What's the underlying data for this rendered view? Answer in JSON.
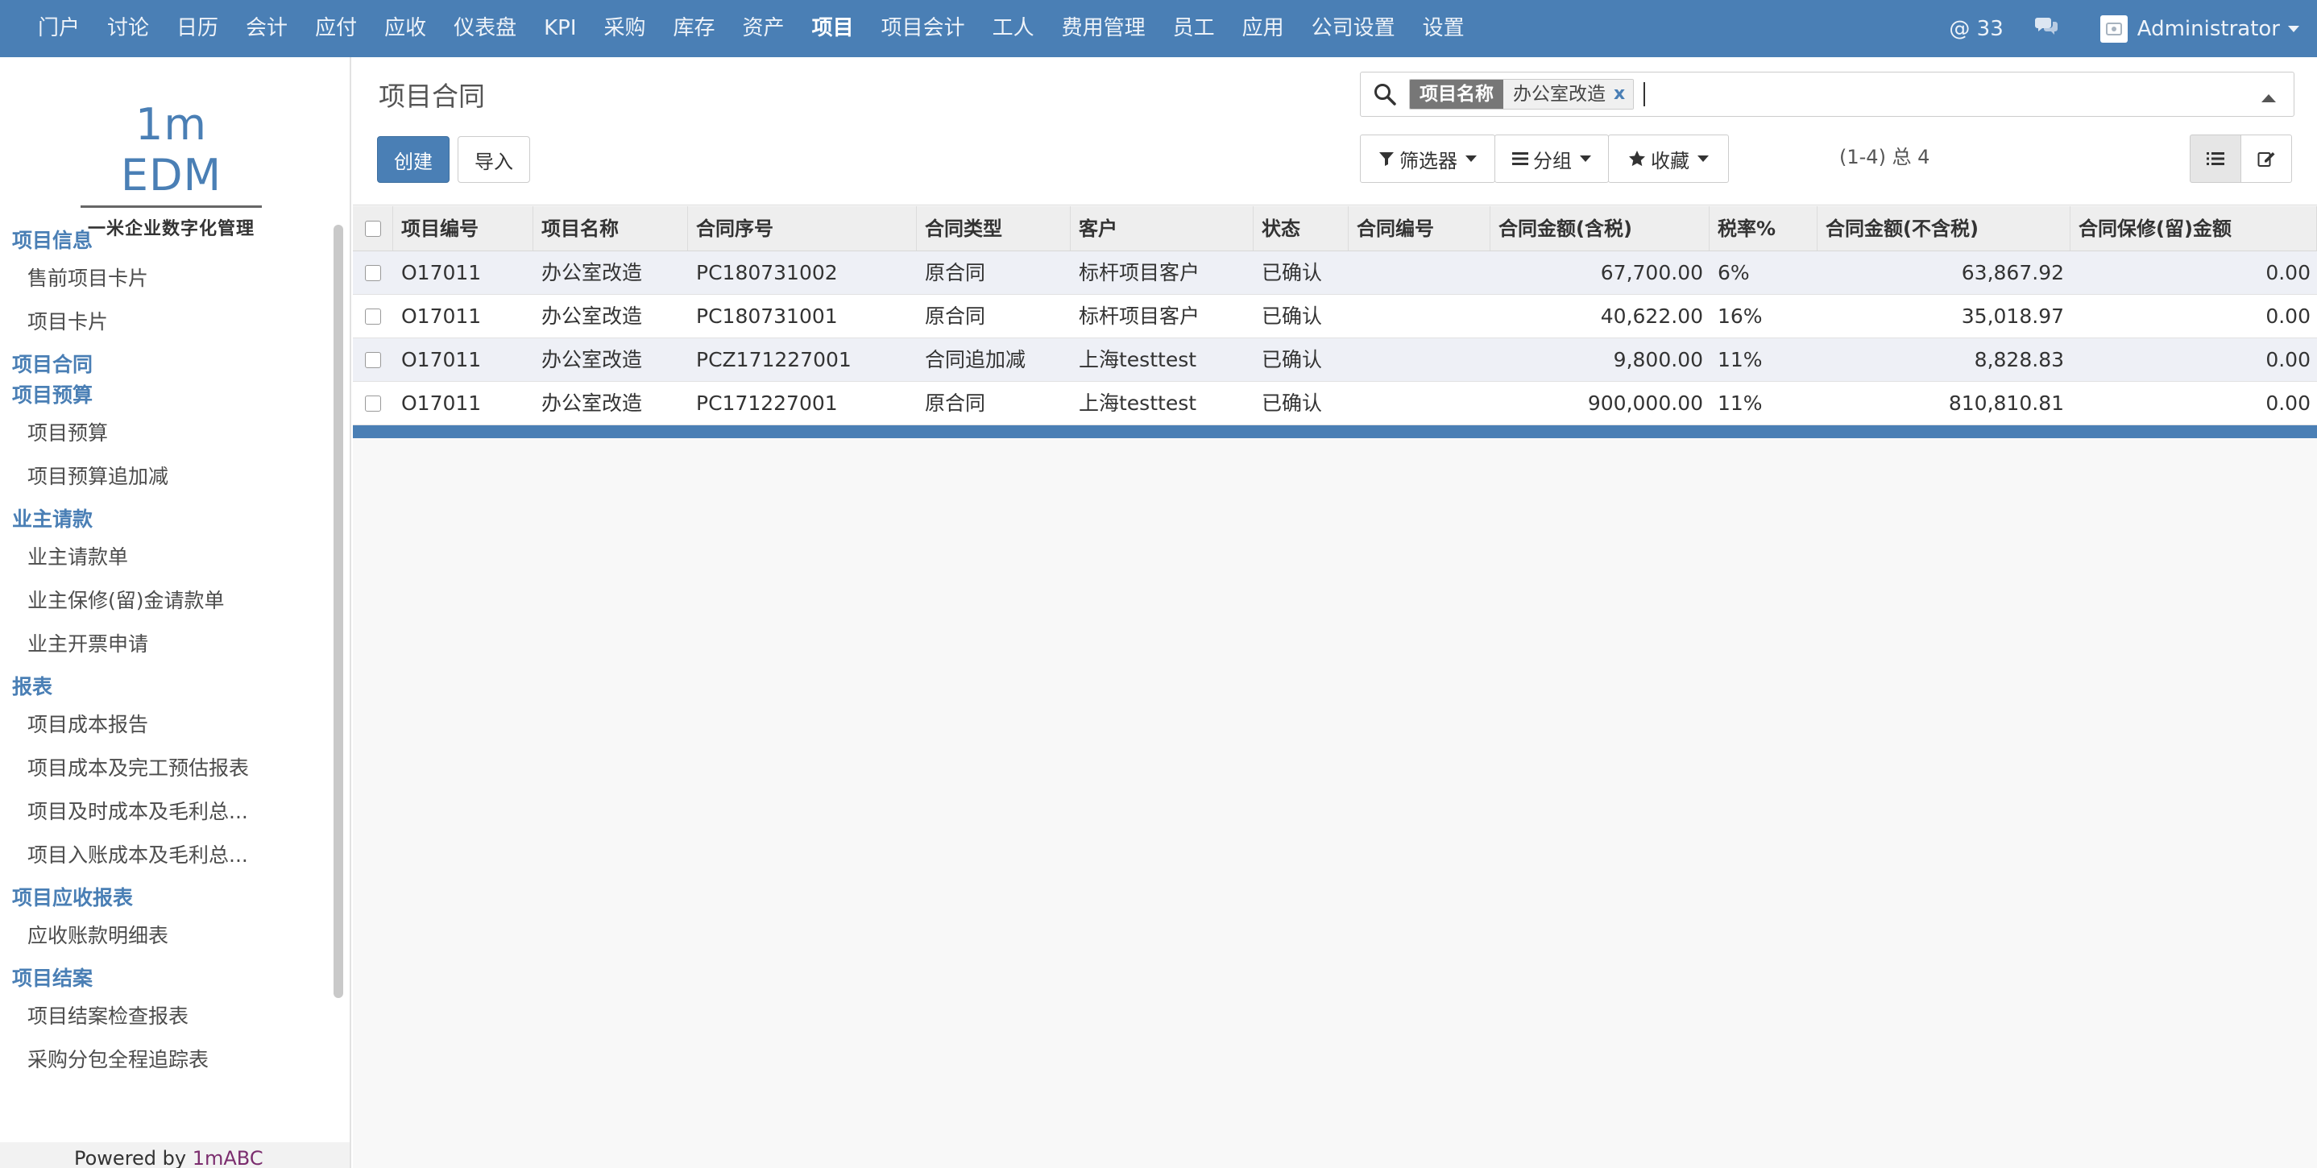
{
  "topnav": {
    "items": [
      "门户",
      "讨论",
      "日历",
      "会计",
      "应付",
      "应收",
      "仪表盘",
      "KPI",
      "采购",
      "库存",
      "资产",
      "项目",
      "项目会计",
      "工人",
      "费用管理",
      "员工",
      "应用",
      "公司设置",
      "设置"
    ],
    "active_index": 11,
    "mentions": "@ 33",
    "user": "Administrator"
  },
  "sidebar": {
    "logo_brand": "1m EDM",
    "logo_tagline": "一米企业数字化管理",
    "menu": [
      {
        "type": "section",
        "label": "项目信息"
      },
      {
        "type": "item",
        "label": "售前项目卡片"
      },
      {
        "type": "item",
        "label": "项目卡片"
      },
      {
        "type": "section",
        "label": "项目合同"
      },
      {
        "type": "section",
        "label": "项目预算"
      },
      {
        "type": "item",
        "label": "项目预算"
      },
      {
        "type": "item",
        "label": "项目预算追加减"
      },
      {
        "type": "section",
        "label": "业主请款"
      },
      {
        "type": "item",
        "label": "业主请款单"
      },
      {
        "type": "item",
        "label": "业主保修(留)金请款单"
      },
      {
        "type": "item",
        "label": "业主开票申请"
      },
      {
        "type": "section",
        "label": "报表"
      },
      {
        "type": "item",
        "label": "项目成本报告"
      },
      {
        "type": "item",
        "label": "项目成本及完工预估报表"
      },
      {
        "type": "item",
        "label": "项目及时成本及毛利总..."
      },
      {
        "type": "item",
        "label": "项目入账成本及毛利总..."
      },
      {
        "type": "section",
        "label": "项目应收报表"
      },
      {
        "type": "item",
        "label": "应收账款明细表"
      },
      {
        "type": "section",
        "label": "项目结案"
      },
      {
        "type": "item",
        "label": "项目结案检查报表"
      },
      {
        "type": "item",
        "label": "采购分包全程追踪表"
      }
    ],
    "powered_prefix": "Powered by ",
    "powered_brand": "1mABC"
  },
  "control": {
    "title": "项目合同",
    "create_label": "创建",
    "import_label": "导入",
    "search_facet_key": "项目名称",
    "search_facet_value": "办公室改造",
    "search_facet_remove": "x",
    "filter_label": "筛选器",
    "group_label": "分组",
    "favorites_label": "收藏",
    "pager": "(1-4) 总 4"
  },
  "table": {
    "columns": [
      "项目编号",
      "项目名称",
      "合同序号",
      "合同类型",
      "客户",
      "状态",
      "合同编号",
      "合同金额(含税)",
      "税率%",
      "合同金额(不含税)",
      "合同保修(留)金额"
    ],
    "rows": [
      [
        "O17011",
        "办公室改造",
        "PC180731002",
        "原合同",
        "标杆项目客户",
        "已确认",
        "",
        "67,700.00",
        "6%",
        "63,867.92",
        "0.00"
      ],
      [
        "O17011",
        "办公室改造",
        "PC180731001",
        "原合同",
        "标杆项目客户",
        "已确认",
        "",
        "40,622.00",
        "16%",
        "35,018.97",
        "0.00"
      ],
      [
        "O17011",
        "办公室改造",
        "PCZ171227001",
        "合同追加减",
        "上海testtest",
        "已确认",
        "",
        "9,800.00",
        "11%",
        "8,828.83",
        "0.00"
      ],
      [
        "O17011",
        "办公室改造",
        "PC171227001",
        "原合同",
        "上海testtest",
        "已确认",
        "",
        "900,000.00",
        "11%",
        "810,810.81",
        "0.00"
      ]
    ],
    "numeric_columns": [
      7,
      9,
      10
    ]
  },
  "colors": {
    "brand": "#4a7fb5",
    "row_stripe": "#eef0f6"
  }
}
